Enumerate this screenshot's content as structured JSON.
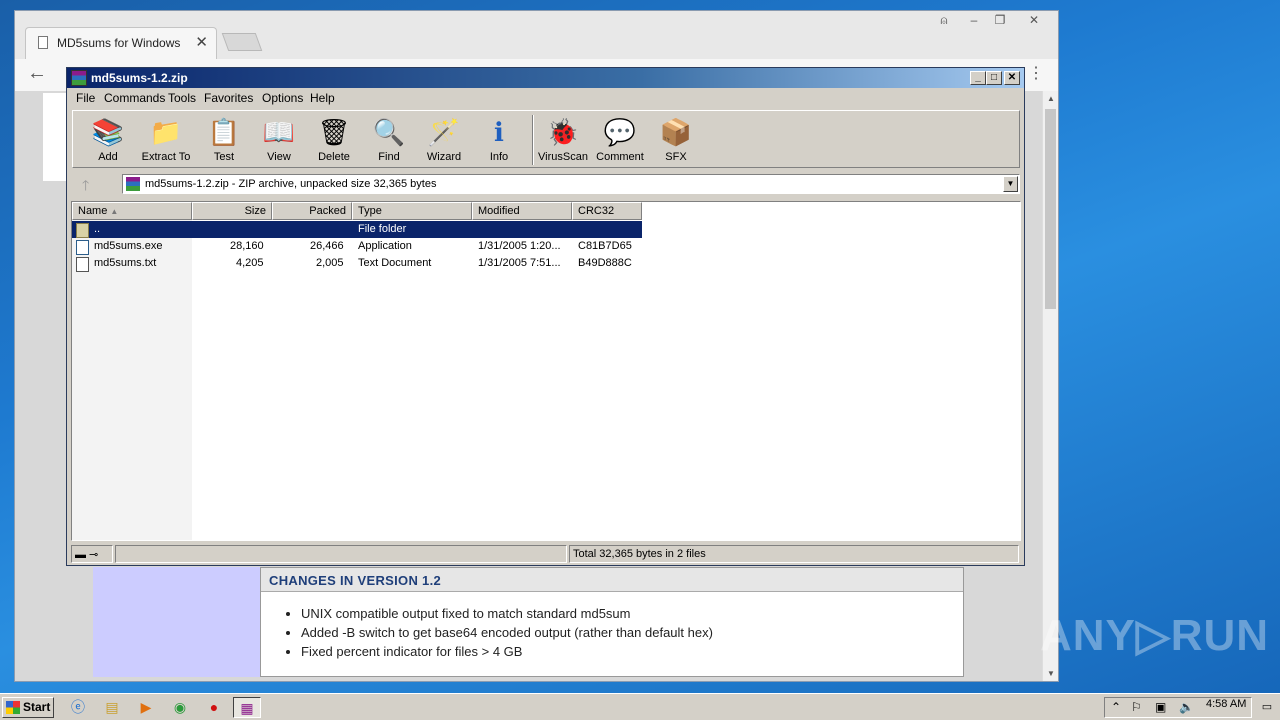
{
  "browser": {
    "tab_title": "MD5sums for Windows",
    "tab_close": "✕",
    "back": "←",
    "menu": "⋮",
    "window_controls": [
      "⍝",
      "–",
      "❐",
      "✕"
    ]
  },
  "webpage": {
    "section_title": "CHANGES IN VERSION 1.2",
    "items": [
      "UNIX compatible output fixed to match standard md5sum",
      "Added -B switch to get base64 encoded output (rather than default hex)",
      "Fixed percent indicator for files > 4 GB"
    ]
  },
  "winrar": {
    "title": "md5sums-1.2.zip",
    "controls": [
      "_",
      "□",
      "✕"
    ],
    "menu": [
      "File",
      "Commands",
      "Tools",
      "Favorites",
      "Options",
      "Help"
    ],
    "toolbar": [
      {
        "label": "Add",
        "icon": "📚"
      },
      {
        "label": "Extract To",
        "icon": "📁"
      },
      {
        "label": "Test",
        "icon": "📋"
      },
      {
        "label": "View",
        "icon": "📖"
      },
      {
        "label": "Delete",
        "icon": "🗑"
      },
      {
        "label": "Find",
        "icon": "🔍"
      },
      {
        "label": "Wizard",
        "icon": "🪄"
      },
      {
        "label": "Info",
        "icon": "ℹ"
      },
      {
        "label": "VirusScan",
        "icon": "🐞"
      },
      {
        "label": "Comment",
        "icon": "💬"
      },
      {
        "label": "SFX",
        "icon": "📦"
      }
    ],
    "address": "md5sums-1.2.zip - ZIP archive, unpacked size 32,365 bytes",
    "columns": [
      "Name",
      "Size",
      "Packed",
      "Type",
      "Modified",
      "CRC32"
    ],
    "rows": [
      {
        "name": "..",
        "size": "",
        "packed": "",
        "type": "File folder",
        "modified": "",
        "crc": ""
      },
      {
        "name": "md5sums.exe",
        "size": "28,160",
        "packed": "26,466",
        "type": "Application",
        "modified": "1/31/2005 1:20...",
        "crc": "C81B7D65"
      },
      {
        "name": "md5sums.txt",
        "size": "4,205",
        "packed": "2,005",
        "type": "Text Document",
        "modified": "1/31/2005 7:51...",
        "crc": "B49D888C"
      }
    ],
    "status": "Total 32,365 bytes in 2 files"
  },
  "taskbar": {
    "start": "Start",
    "clock": "4:58 AM"
  },
  "watermark": "ANY▷RUN"
}
